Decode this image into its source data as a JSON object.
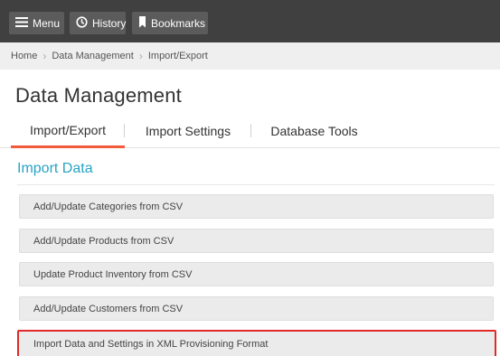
{
  "topbar": {
    "menu_label": "Menu",
    "history_label": "History",
    "bookmarks_label": "Bookmarks",
    "menu_icon": "hamburger-icon",
    "history_icon": "clock-icon",
    "bookmarks_icon": "bookmark-icon",
    "background_color": "#404040"
  },
  "breadcrumb": {
    "items": [
      "Home",
      "Data Management",
      "Import/Export"
    ]
  },
  "page": {
    "title": "Data Management"
  },
  "tabs": [
    {
      "label": "Import/Export",
      "active": true
    },
    {
      "label": "Import Settings",
      "active": false
    },
    {
      "label": "Database Tools",
      "active": false
    }
  ],
  "section": {
    "title": "Import Data",
    "accent_color": "#29a3c2"
  },
  "actions": [
    {
      "label": "Add/Update Categories from CSV"
    },
    {
      "label": "Add/Update Products from CSV"
    },
    {
      "label": "Update Product Inventory from CSV"
    },
    {
      "label": "Add/Update Customers from CSV"
    },
    {
      "label": "Import Data and Settings in XML Provisioning Format",
      "highlighted": true
    }
  ],
  "colors": {
    "active_tab_underline": "#f15a3a",
    "highlight_border": "#e02a2a"
  }
}
